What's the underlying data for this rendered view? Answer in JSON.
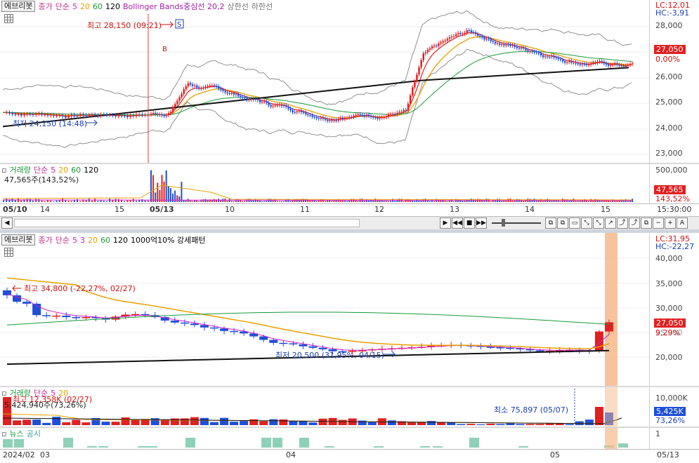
{
  "top": {
    "tabs": {
      "stock": "에브리봇",
      "price_label": "종가",
      "ma_type": "단순",
      "ma": [
        "5",
        "20",
        "60",
        "120"
      ],
      "bb": "Bollinger Bands중심선 20,2",
      "upper": "상한선",
      "lower": "하한선"
    },
    "lc": "LC:12,01",
    "hc": "HC:-3,91",
    "y_ticks": [
      "28,000",
      "27,000",
      "26,000",
      "25,000",
      "24,000",
      "23,000"
    ],
    "price_box": "27,050",
    "pct_box": "0,00%",
    "high_ann": "최고 28,150 (09:21)",
    "low_ann": "최저 24,150 (14:48)",
    "marker_s": "S",
    "marker_b": "B",
    "vol": {
      "label": "거래량",
      "ma_type": "단순",
      "ma": [
        "5",
        "20",
        "60",
        "120"
      ],
      "value": "47,565주(143,52%)",
      "y_tick": "500,000",
      "box1": "47,565",
      "box2": "143,52%"
    },
    "x_ticks": [
      "05/10",
      "14",
      "15",
      "05/13",
      "10",
      "11",
      "12",
      "13",
      "14",
      "15"
    ],
    "time": "15:30:00"
  },
  "toolbar": {
    "play": "▶",
    "rew": "◀◀",
    "stop": "■",
    "ff": "▶▶",
    "plus": "+",
    "minus": "−",
    "a": "A"
  },
  "bottom": {
    "tabs": {
      "stock": "에브리봇",
      "price_label": "종가",
      "ma_type": "단순",
      "ma": [
        "5",
        "3",
        "20",
        "60",
        "120"
      ],
      "pattern": "1000억10% 강세패턴"
    },
    "lc": "LC:31,95",
    "hc": "HC:-22,27",
    "y_ticks": [
      "40,000",
      "35,000",
      "30,000",
      "25,000",
      "20,000"
    ],
    "price_box": "27,050",
    "pct_box": "9,29%",
    "high_ann": "최고 34,800 (-22,27%, 02/27)",
    "low_ann": "최저 20,500 (31,95%, 04/15)",
    "vol": {
      "label": "거래량",
      "ma_type": "단순",
      "ma": [
        "5",
        "20"
      ],
      "high": "최고 12,358K (02/27)",
      "value": "5,424,940주(73,26%)",
      "min": "최소 75,897 (05/07)",
      "y_tick": "10,000K",
      "box1": "5,425K",
      "box2": "73,26%"
    },
    "news": {
      "label": "뉴스",
      "sub": "공시",
      "tick": "1"
    },
    "x_ticks": [
      "2024/02",
      "03",
      "04",
      "05"
    ],
    "date": "05/13"
  },
  "colors": {
    "up": "#e02020",
    "down": "#1f4fd8",
    "ma5": "#d020d0",
    "ma20": "#e8a000",
    "ma60": "#1a9a3a",
    "ma120": "#000000",
    "bb": "#909090",
    "news": "#8fd0b8"
  },
  "chart_data": [
    {
      "type": "line",
      "title": "",
      "y_ticks": [
        28000,
        27000,
        26000,
        25000,
        24000,
        23000
      ],
      "ylim": [
        22500,
        28600
      ],
      "series": [
        {
          "name": "종가",
          "x": [
            "05/10",
            "05/13",
            "05/14",
            "05/15"
          ],
          "values": [
            24650,
            27200,
            26500,
            27050
          ]
        }
      ]
    },
    {
      "type": "bar",
      "title": "",
      "y_ticks": [
        500000
      ],
      "series": [
        {
          "name": "거래량",
          "values": [
            47565
          ]
        }
      ]
    },
    {
      "type": "line",
      "title": "",
      "y_ticks": [
        40000,
        35000,
        30000,
        25000,
        20000
      ],
      "ylim": [
        17500,
        41500
      ],
      "series": [
        {
          "name": "종가",
          "x": [
            "02/27",
            "04/15",
            "05/13"
          ],
          "values": [
            34800,
            20500,
            27050
          ]
        }
      ]
    }
  ]
}
